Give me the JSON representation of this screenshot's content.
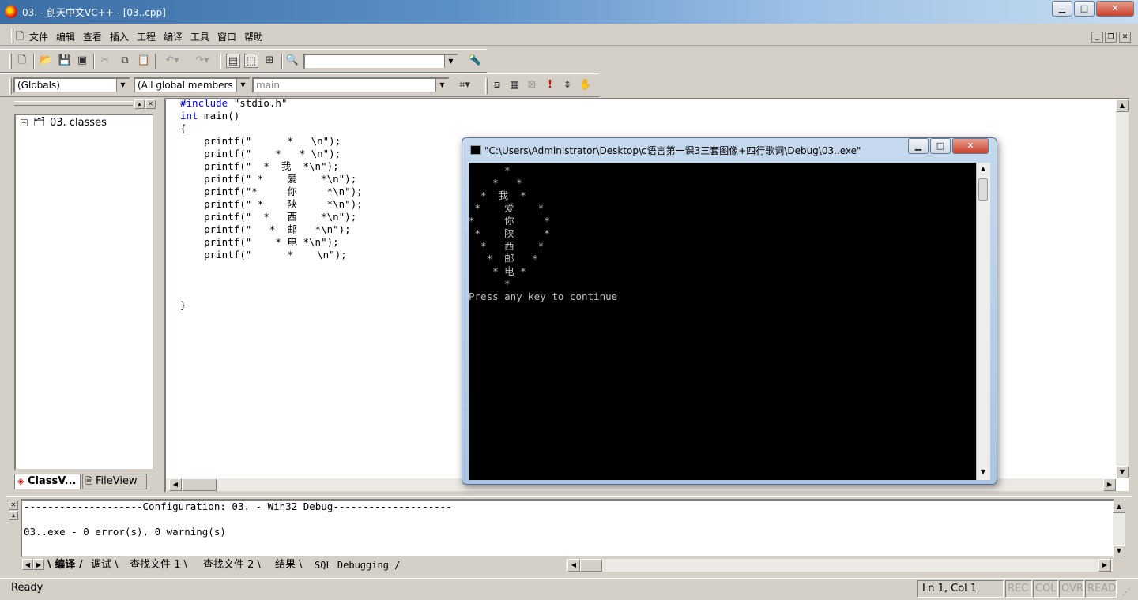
{
  "window": {
    "title": "03. - 创天中文VC++ - [03..cpp]"
  },
  "menu": [
    "文件",
    "编辑",
    "查看",
    "插入",
    "工程",
    "编译",
    "工具",
    "窗口",
    "帮助"
  ],
  "toolbar": {
    "find_combo_value": "",
    "globals_combo": "(Globals)",
    "members_combo": "(All global members",
    "function_combo": "main"
  },
  "workspace": {
    "tree_root": "03. classes",
    "tabs": [
      "ClassV...",
      "FileView"
    ]
  },
  "editor": {
    "lines": [
      {
        "kw": "#include",
        "rest": " \"stdio.h\""
      },
      {
        "kw": "int",
        "rest": " main()"
      },
      {
        "kw": "",
        "rest": "{"
      },
      {
        "kw": "",
        "rest": "    printf(\"      *   \\n\");"
      },
      {
        "kw": "",
        "rest": "    printf(\"    *   * \\n\");"
      },
      {
        "kw": "",
        "rest": "    printf(\"  *  我  *\\n\");"
      },
      {
        "kw": "",
        "rest": "    printf(\" *    爱    *\\n\");"
      },
      {
        "kw": "",
        "rest": "    printf(\"*     你     *\\n\");"
      },
      {
        "kw": "",
        "rest": "    printf(\" *    陕     *\\n\");"
      },
      {
        "kw": "",
        "rest": "    printf(\"  *   西    *\\n\");"
      },
      {
        "kw": "",
        "rest": "    printf(\"   *  邮   *\\n\");"
      },
      {
        "kw": "",
        "rest": "    printf(\"    * 电 *\\n\");"
      },
      {
        "kw": "",
        "rest": "    printf(\"      *    \\n\");"
      },
      {
        "kw": "",
        "rest": ""
      },
      {
        "kw": "",
        "rest": ""
      },
      {
        "kw": "",
        "rest": ""
      },
      {
        "kw": "",
        "rest": "}"
      }
    ]
  },
  "console": {
    "title": "\"C:\\Users\\Administrator\\Desktop\\c语言第一课3三套图像+四行歌词\\Debug\\03..exe\"",
    "output": [
      "      *",
      "    *   *",
      "  *  我  *",
      " *    爱    *",
      "*     你     *",
      " *    陕     *",
      "  *   西    *",
      "   *  邮   *",
      "    * 电 *",
      "      *",
      "Press any key to continue"
    ]
  },
  "output_pane": {
    "lines": [
      "--------------------Configuration: 03. - Win32 Debug--------------------",
      "",
      "03..exe - 0 error(s), 0 warning(s)"
    ],
    "tabs": [
      "编译",
      "调试",
      "查找文件 1",
      "查找文件 2",
      "结果",
      "SQL Debugging"
    ]
  },
  "statusbar": {
    "message": "Ready",
    "position": "Ln 1, Col 1",
    "indicators": [
      "REC",
      "COL",
      "OVR",
      "READ"
    ]
  }
}
